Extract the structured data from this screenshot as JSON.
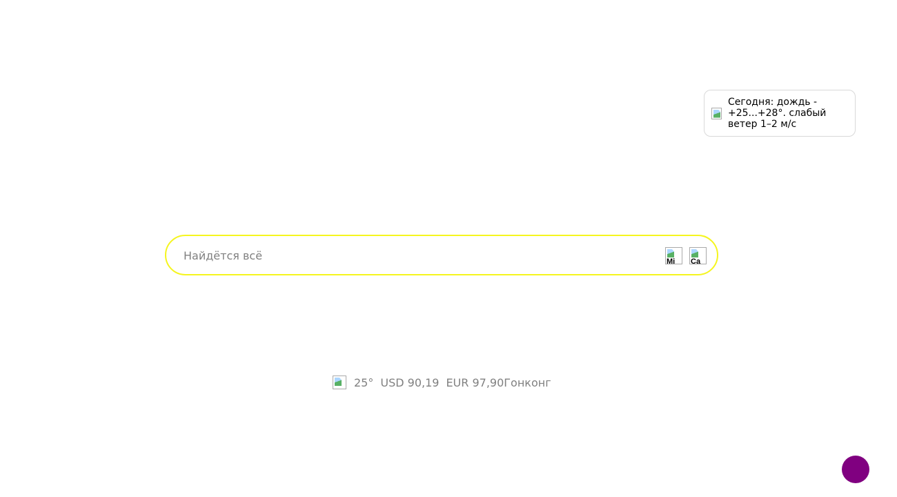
{
  "weather_popup": {
    "icon": "weather-icon",
    "text": "Сегодня: дождь - +25...+28°. слабый ветер 1–2 м/с"
  },
  "search": {
    "placeholder": "Найдётся всё",
    "value": "",
    "mic_icon_alt": "Mi",
    "camera_icon_alt": "Ca"
  },
  "info": {
    "weather_icon": "weather-icon",
    "temperature": "25°",
    "usd": "USD 90,19",
    "eur": "EUR 97,90",
    "city": "Гонконг"
  },
  "colors": {
    "search_border": "#f5f51e",
    "fab": "#800080",
    "muted_text": "#808080"
  }
}
